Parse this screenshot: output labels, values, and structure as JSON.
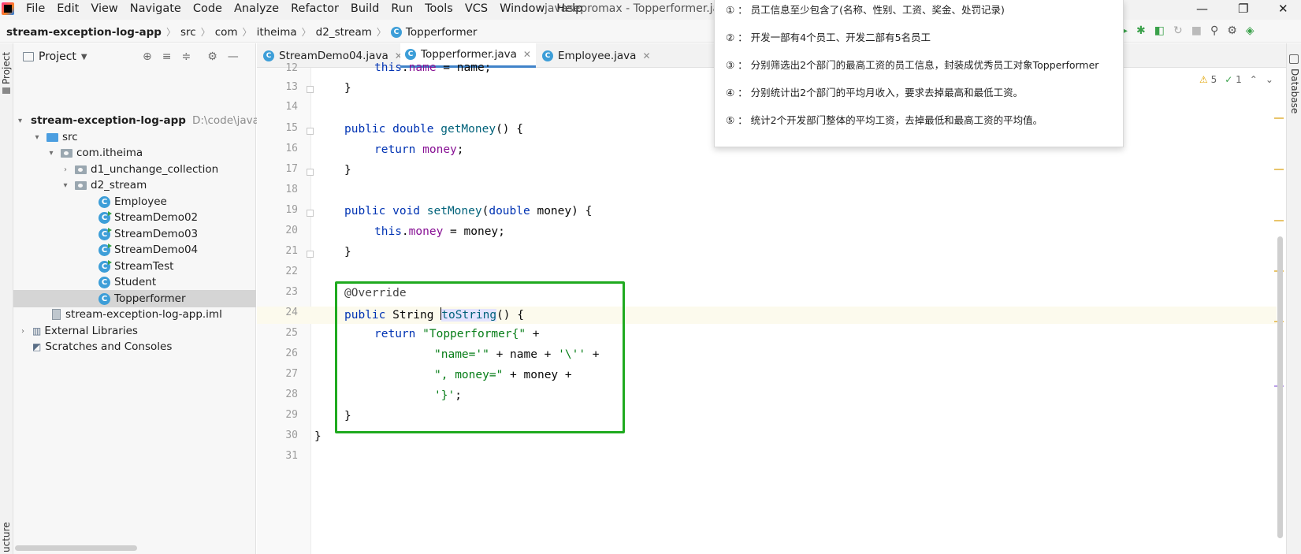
{
  "menubar": {
    "items": [
      "File",
      "Edit",
      "View",
      "Navigate",
      "Code",
      "Analyze",
      "Refactor",
      "Build",
      "Run",
      "Tools",
      "VCS",
      "Window",
      "Help"
    ],
    "window_title": "javasepromax - Topperformer.java"
  },
  "breadcrumb": {
    "items": [
      "stream-exception-log-app",
      "src",
      "com",
      "itheima",
      "d2_stream",
      "Topperformer"
    ]
  },
  "project_panel": {
    "title": "Project",
    "tree": [
      {
        "label": "stream-exception-log-app",
        "path": "D:\\code\\java"
      },
      {
        "label": "src"
      },
      {
        "label": "com.itheima"
      },
      {
        "label": "d1_unchange_collection"
      },
      {
        "label": "d2_stream"
      },
      {
        "label": "Employee"
      },
      {
        "label": "StreamDemo02"
      },
      {
        "label": "StreamDemo03"
      },
      {
        "label": "StreamDemo04"
      },
      {
        "label": "StreamTest"
      },
      {
        "label": "Student"
      },
      {
        "label": "Topperformer"
      },
      {
        "label": "stream-exception-log-app.iml"
      },
      {
        "label": "External Libraries"
      },
      {
        "label": "Scratches and Consoles"
      }
    ]
  },
  "left_strip": {
    "project_label": "Project",
    "structure_label": "ucture"
  },
  "right_strip": {
    "database_label": "Database"
  },
  "tabs": [
    {
      "label": "StreamDemo04.java"
    },
    {
      "label": "Topperformer.java"
    },
    {
      "label": "Employee.java"
    }
  ],
  "editor": {
    "line_numbers": [
      "12",
      "13",
      "14",
      "15",
      "16",
      "17",
      "18",
      "19",
      "20",
      "21",
      "22",
      "23",
      "24",
      "25",
      "26",
      "27",
      "28",
      "29",
      "30",
      "31"
    ],
    "current_line": "24",
    "inspection": {
      "warnings": "5",
      "checks": "1"
    }
  },
  "note": {
    "items": [
      "① ： 员工信息至少包含了(名称、性别、工资、奖金、处罚记录)",
      "② ： 开发一部有4个员工、开发二部有5名员工",
      "③ ： 分别筛选出2个部门的最高工资的员工信息，封装成优秀员工对象Topperformer",
      "④ ： 分别统计出2个部门的平均月收入，要求去掉最高和最低工资。",
      "⑤ ： 统计2个开发部门整体的平均工资，去掉最低和最高工资的平均值。"
    ]
  }
}
